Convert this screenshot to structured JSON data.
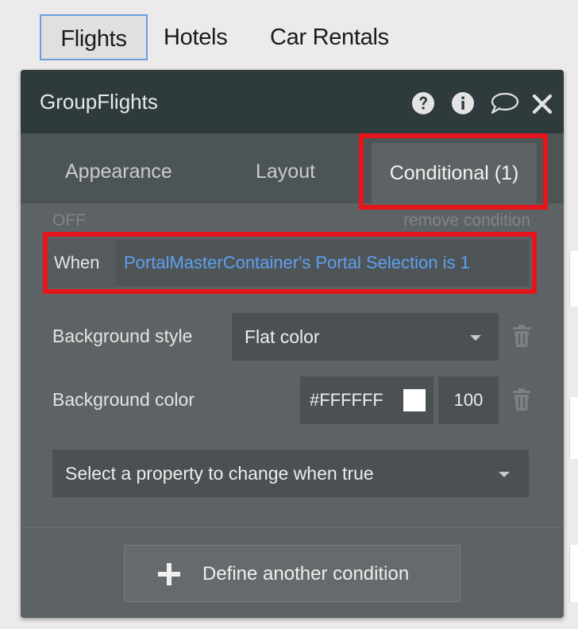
{
  "page_tabs": [
    "Flights",
    "Hotels",
    "Car Rentals"
  ],
  "panel": {
    "title": "GroupFlights",
    "header_icons": [
      "help-icon",
      "info-icon",
      "comment-icon",
      "close-icon"
    ],
    "tabs": [
      "Appearance",
      "Layout",
      "Conditional (1)"
    ],
    "active_tab": "Conditional (1)"
  },
  "condition": {
    "status": "OFF",
    "remove_label": "remove condition",
    "when_label": "When",
    "expression": "PortalMasterContainer's Portal Selection is 1"
  },
  "properties": {
    "background_style": {
      "label": "Background style",
      "value": "Flat color"
    },
    "background_color": {
      "label": "Background color",
      "hex": "#FFFFFF",
      "opacity": "100"
    },
    "select_placeholder": "Select a property to change when true"
  },
  "define_button": "Define another condition",
  "colors": {
    "panel_bg": "#5d6364",
    "header_bg": "#2f3a3d",
    "expression_text": "#5da0f0",
    "highlight_box": "#e6141b",
    "swatch": "#ffffff"
  }
}
